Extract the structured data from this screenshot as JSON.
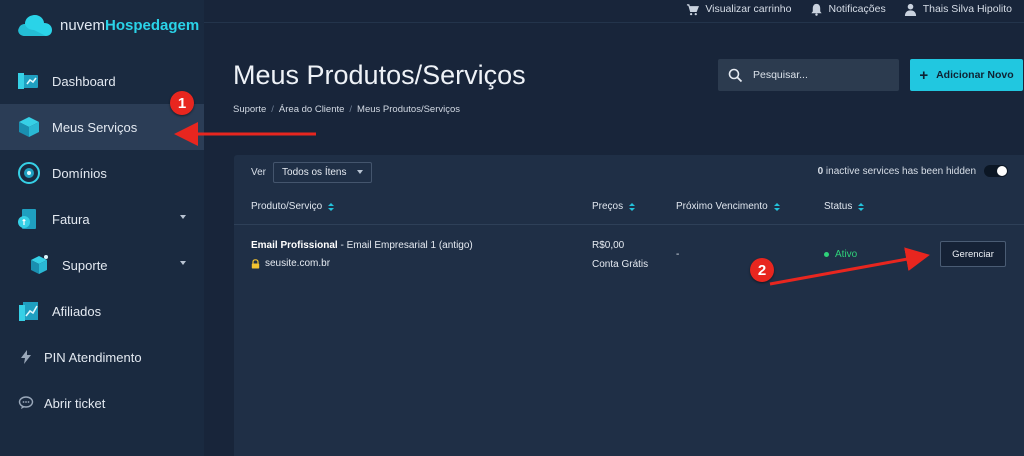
{
  "app": {
    "logo_prefix": "nuvem",
    "logo_brand": "Hospedagem",
    "colors": {
      "accent": "#21c7e0",
      "status_active": "#2fd27a",
      "annotation": "#e8261f"
    }
  },
  "topbar": {
    "cart": "Visualizar carrinho",
    "notifications": "Notificações",
    "user": "Thais Silva Hipolito"
  },
  "sidebar": {
    "items": [
      {
        "label": "Dashboard",
        "icon": "dashboard-icon"
      },
      {
        "label": "Meus Serviços",
        "icon": "box-icon",
        "active": true
      },
      {
        "label": "Domínios",
        "icon": "globe-icon"
      },
      {
        "label": "Fatura",
        "icon": "invoice-icon",
        "has_submenu": true
      },
      {
        "label": "Suporte",
        "icon": "support-cube-icon",
        "has_submenu": true
      },
      {
        "label": "Afiliados",
        "icon": "chart-icon"
      },
      {
        "label": "PIN Atendimento",
        "icon": "bolt-icon"
      },
      {
        "label": "Abrir ticket",
        "icon": "chat-icon"
      }
    ]
  },
  "header": {
    "title": "Meus Produtos/Serviços",
    "breadcrumb": [
      "Suporte",
      "Área do Cliente",
      "Meus Produtos/Serviços"
    ],
    "search_placeholder": "Pesquisar...",
    "add_button": "Adicionar Novo"
  },
  "panel": {
    "filter_label": "Ver",
    "filter_value": "Todos os Ítens",
    "inactive_count": "0",
    "inactive_text": "inactive services has been hidden",
    "columns": {
      "product": "Produto/Serviço",
      "price": "Preços",
      "due": "Próximo Vencimento",
      "status": "Status"
    },
    "rows": [
      {
        "product_name": "Email Profissional",
        "product_detail": " - Email Empresarial 1 (antigo)",
        "domain": "seusite.com.br",
        "price": "R$0,00",
        "billing": "Conta Grátis",
        "due": "-",
        "status": "Ativo",
        "action": "Gerenciar"
      }
    ]
  },
  "annotations": {
    "badge1": "1",
    "badge2": "2"
  }
}
